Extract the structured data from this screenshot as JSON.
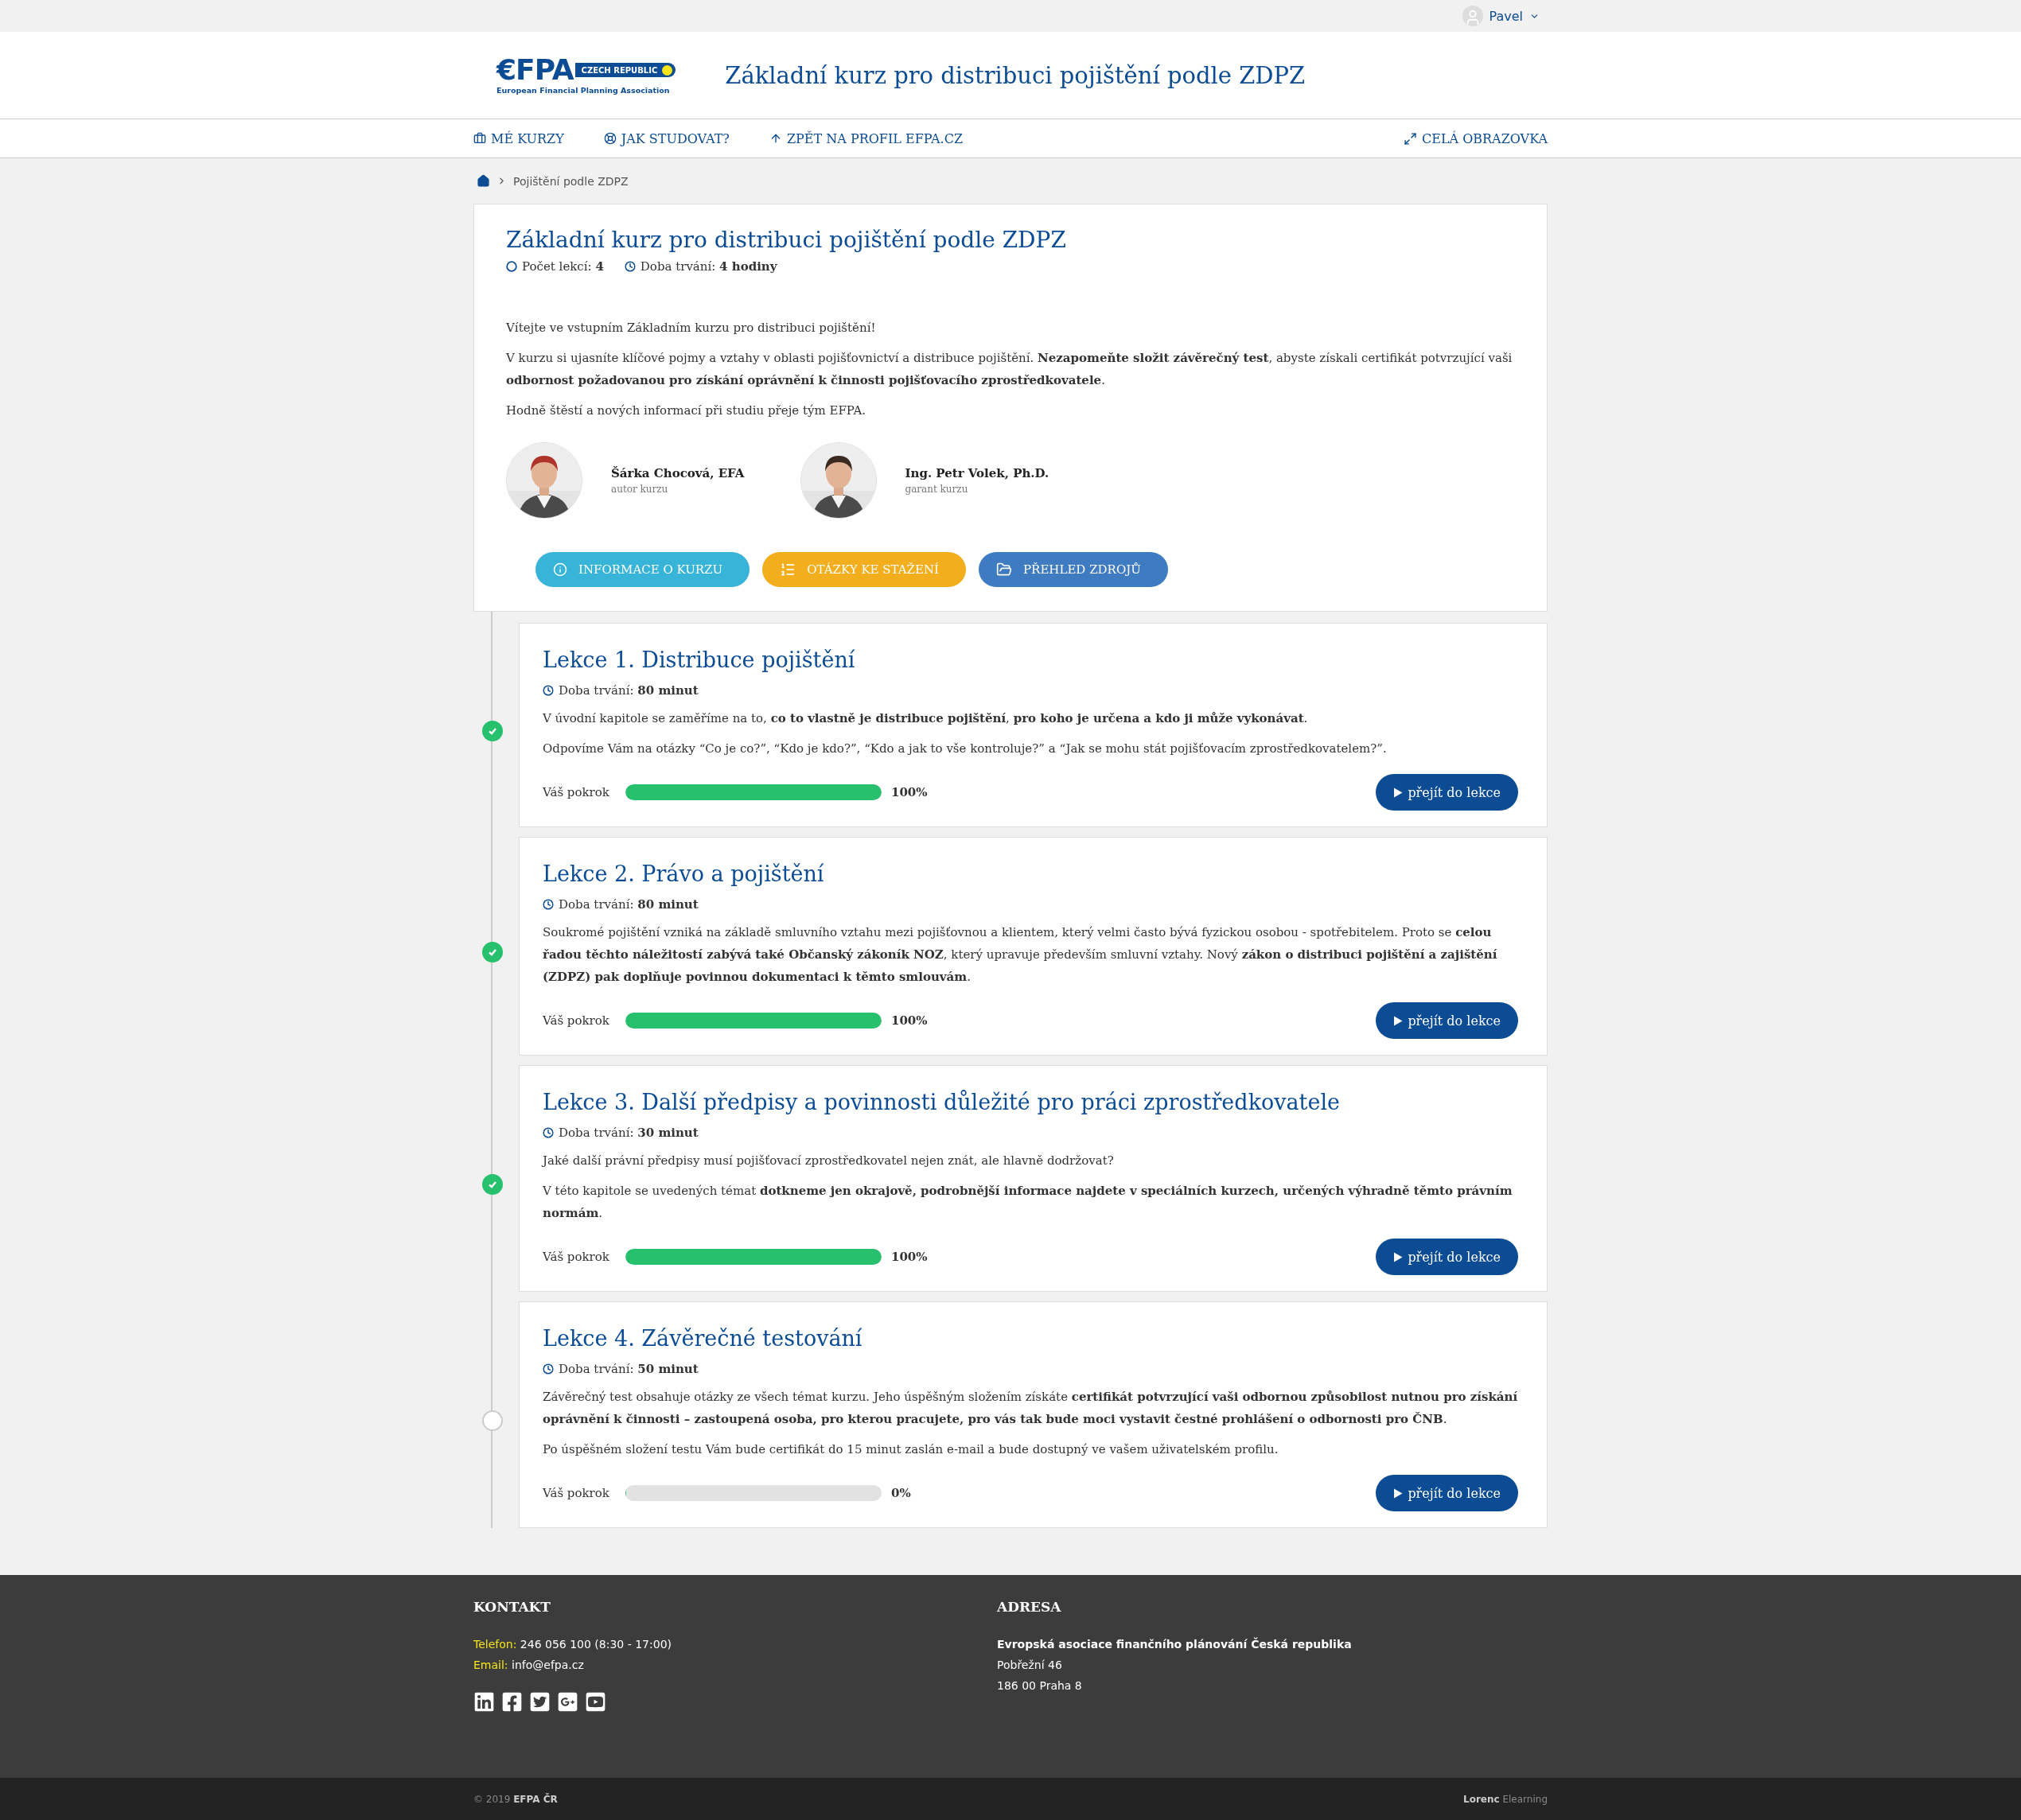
{
  "top_bar": {
    "user": "Pavel"
  },
  "header": {
    "logo": {
      "mark": "€FPA",
      "badge": "CZECH REPUBLIC",
      "tagline": "European Financial Planning Association"
    },
    "title": "Základní kurz pro distribuci pojištění podle ZDPZ"
  },
  "nav": {
    "items": [
      {
        "label": "MÉ KURZY"
      },
      {
        "label": "JAK STUDOVAT?"
      },
      {
        "label": "ZPĚT NA PROFIL EFPA.CZ"
      }
    ],
    "fullscreen": "CELÁ OBRAZOVKA"
  },
  "breadcrumb": [
    "Pojištění podle ZDPZ"
  ],
  "course": {
    "title": "Základní kurz pro distribuci pojištění podle ZDPZ",
    "meta": [
      {
        "label": "Počet lekcí:",
        "value": "4"
      },
      {
        "label": "Doba trvání:",
        "value": "4 hodiny"
      }
    ],
    "paragraphs": [
      "Vítejte ve vstupním Základním kurzu pro distribuci pojištění!",
      "V kurzu si ujasníte klíčové pojmy a vztahy v oblasti pojišťovnictví a distribuce pojištění. **Nezapomeňte složit závěrečný test**, abyste získali certifikát potvrzující vaši **odbornost požadovanou pro získání oprávnění k činnosti pojišťovacího zprostředkovatele**.",
      "Hodně štěstí a nových informací při studiu přeje tým EFPA."
    ],
    "people": [
      {
        "name": "Šárka Chocová, EFA",
        "role": "autor kurzu"
      },
      {
        "name": "Ing. Petr Volek, Ph.D.",
        "role": "garant kurzu"
      }
    ],
    "buttons": [
      {
        "label": "INFORMACE O KURZU",
        "color": "#38b4d8"
      },
      {
        "label": "OTÁZKY KE STAŽENÍ",
        "color": "#f2ae1c"
      },
      {
        "label": "PŘEHLED ZDROJŮ",
        "color": "#3f7bc1"
      }
    ]
  },
  "lessons": [
    {
      "title": "Lekce 1. Distribuce pojištění",
      "duration_label": "Doba trvání:",
      "duration": "80 minut",
      "completed": true,
      "paragraphs": [
        "V úvodní kapitole se zaměříme na to, **co to vlastně je distribuce pojištění**, **pro koho je určena a kdo ji může vykonávat**.",
        "Odpovíme Vám na otázky “Co je co?”, “Kdo je kdo?”, “Kdo a jak to vše kontroluje?” a “Jak se mohu stát pojišťovacím zprostředkovatelem?”."
      ],
      "progress_label": "Váš pokrok",
      "level": 1,
      "reading": "100%",
      "button": "přejít do lekce"
    },
    {
      "title": "Lekce 2. Právo a pojištění",
      "duration_label": "Doba trvání:",
      "duration": "80 minut",
      "completed": true,
      "paragraphs": [
        "Soukromé pojištění vzniká na základě smluvního vztahu mezi pojišťovnou a klientem, který velmi často bývá fyzickou osobou - spotřebitelem. Proto se **celou řadou těchto náležitostí zabývá také Občanský zákoník NOZ**, který upravuje především smluvní vztahy. Nový **zákon o distribuci pojištění a zajištění (ZDPZ) pak doplňuje povinnou dokumentaci k těmto smlouvám**."
      ],
      "progress_label": "Váš pokrok",
      "level": 1,
      "reading": "100%",
      "button": "přejít do lekce"
    },
    {
      "title": "Lekce 3. Další předpisy a povinnosti důležité pro práci zprostředkovatele",
      "duration_label": "Doba trvání:",
      "duration": "30 minut",
      "completed": true,
      "paragraphs": [
        "Jaké další právní předpisy musí pojišťovací zprostředkovatel nejen znát, ale hlavně dodržovat?",
        "V této kapitole se uvedených témat **dotkneme jen okrajově, podrobnější informace najdete v speciálních kurzech, určených výhradně těmto právním normám**."
      ],
      "progress_label": "Váš pokrok",
      "level": 1,
      "reading": "100%",
      "button": "přejít do lekce"
    },
    {
      "title": "Lekce 4. Závěrečné testování",
      "duration_label": "Doba trvání:",
      "duration": "50 minut",
      "completed": false,
      "paragraphs": [
        "Závěrečný test obsahuje otázky ze všech témat kurzu. Jeho úspěšným složením získáte **certifikát potvrzující vaši odbornou způsobilost nutnou pro získání oprávnění k činnosti – zastoupená osoba, pro kterou pracujete, pro vás tak bude moci vystavit čestné prohlášení o odbornosti pro ČNB**.",
        "Po úspěšném složení testu Vám bude certifikát do 15 minut zaslán e-mail a bude dostupný ve vašem uživatelském profilu."
      ],
      "progress_label": "Váš pokrok",
      "level": 0,
      "reading": "0%",
      "button": "přejít do lekce"
    }
  ],
  "footer": {
    "contact": {
      "title": "KONTAKT",
      "lines": [
        {
          "label": "Telefon:",
          "value": "246 056 100 (8:30 - 17:00)"
        },
        {
          "label": "Email:",
          "value": "info@efpa.cz"
        }
      ]
    },
    "address": {
      "title": "ADRESA",
      "lines": [
        "**Evropská asociace finančního plánování Česká republika**",
        "Pobřežní 46",
        "186 00 Praha 8"
      ]
    }
  },
  "bottom_bar": {
    "copyright": "© 2019 **EFPA ČR**",
    "credit": "**Lorenc** Elearning"
  }
}
